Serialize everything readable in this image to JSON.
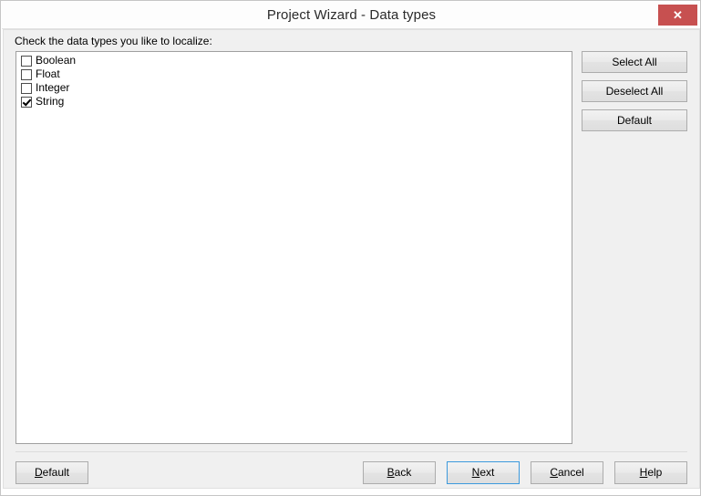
{
  "window": {
    "title": "Project Wizard - Data types",
    "close_label": "✕",
    "close_icon": "close-icon",
    "close_color": "#c75050"
  },
  "content": {
    "prompt": "Check the data types you like to localize:",
    "items": [
      {
        "label": "Boolean",
        "checked": false
      },
      {
        "label": "Float",
        "checked": false
      },
      {
        "label": "Integer",
        "checked": false
      },
      {
        "label": "String",
        "checked": true
      }
    ]
  },
  "side_buttons": [
    {
      "label": "Select All",
      "name": "select-all-button"
    },
    {
      "label": "Deselect All",
      "name": "deselect-all-button"
    },
    {
      "label": "Default",
      "name": "default-list-button"
    }
  ],
  "footer": {
    "default": {
      "pre": "",
      "mnemonic": "D",
      "post": "efault"
    },
    "back": {
      "pre": "",
      "mnemonic": "B",
      "post": "ack"
    },
    "next": {
      "pre": "",
      "mnemonic": "N",
      "post": "ext"
    },
    "cancel": {
      "pre": "",
      "mnemonic": "C",
      "post": "ancel"
    },
    "help": {
      "pre": "",
      "mnemonic": "H",
      "post": "elp"
    }
  },
  "colors": {
    "accent_focus": "#3c99dc",
    "close_red": "#c75050",
    "dialog_bg": "#f0f0f0",
    "list_bg": "#ffffff"
  }
}
